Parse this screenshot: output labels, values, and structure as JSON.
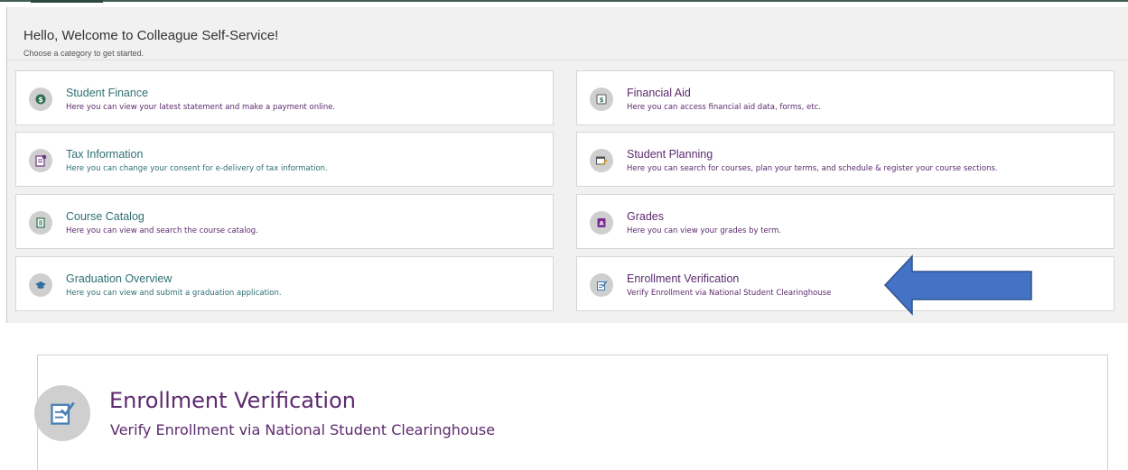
{
  "header": {
    "title": "Hello, Welcome to Colleague Self-Service!",
    "subtitle": "Choose a category to get started."
  },
  "tiles": [
    {
      "title": "Student Finance",
      "description": "Here you can view your latest statement and make a payment online.",
      "icon": "dollar-coin-icon"
    },
    {
      "title": "Financial Aid",
      "description": "Here you can access financial aid data, forms, etc.",
      "icon": "money-bill-icon"
    },
    {
      "title": "Tax Information",
      "description": "Here you can change your consent for e-delivery of tax information.",
      "icon": "tax-form-icon"
    },
    {
      "title": "Student Planning",
      "description": "Here you can search for courses, plan your terms, and schedule & register your course sections.",
      "icon": "calendar-pencil-icon"
    },
    {
      "title": "Course Catalog",
      "description": "Here you can view and search the course catalog.",
      "icon": "catalog-book-icon"
    },
    {
      "title": "Grades",
      "description": "Here you can view your grades by term.",
      "icon": "grade-report-icon"
    },
    {
      "title": "Graduation Overview",
      "description": "Here you can view and submit a graduation application.",
      "icon": "graduation-cap-icon"
    },
    {
      "title": "Enrollment Verification",
      "description": "Verify Enrollment via National Student Clearinghouse",
      "icon": "verification-form-icon"
    }
  ],
  "zoom": {
    "title": "Enrollment Verification",
    "description": "Verify Enrollment via National Student Clearinghouse",
    "icon": "verification-form-icon"
  },
  "colors": {
    "title_purple": "#5c2a6e",
    "title_teal": "#2f6f73",
    "arrow_blue": "#4472c4",
    "arrow_border": "#2f528f",
    "icon_circle": "#cfcfcf"
  }
}
